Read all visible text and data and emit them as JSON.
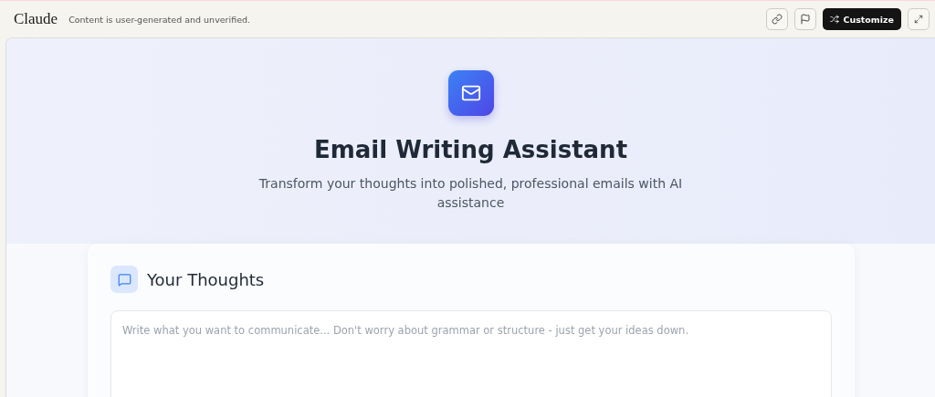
{
  "topbar": {
    "logo": "Claude",
    "notice": "Content is user-generated and unverified.",
    "customize_button": "Customize"
  },
  "hero": {
    "title": "Email Writing Assistant",
    "subtitle": "Transform your thoughts into polished, professional emails with AI assistance"
  },
  "thoughts_card": {
    "title": "Your Thoughts",
    "input": {
      "placeholder": "Write what you want to communicate... Don't worry about grammar or structure - just get your ideas down."
    }
  }
}
